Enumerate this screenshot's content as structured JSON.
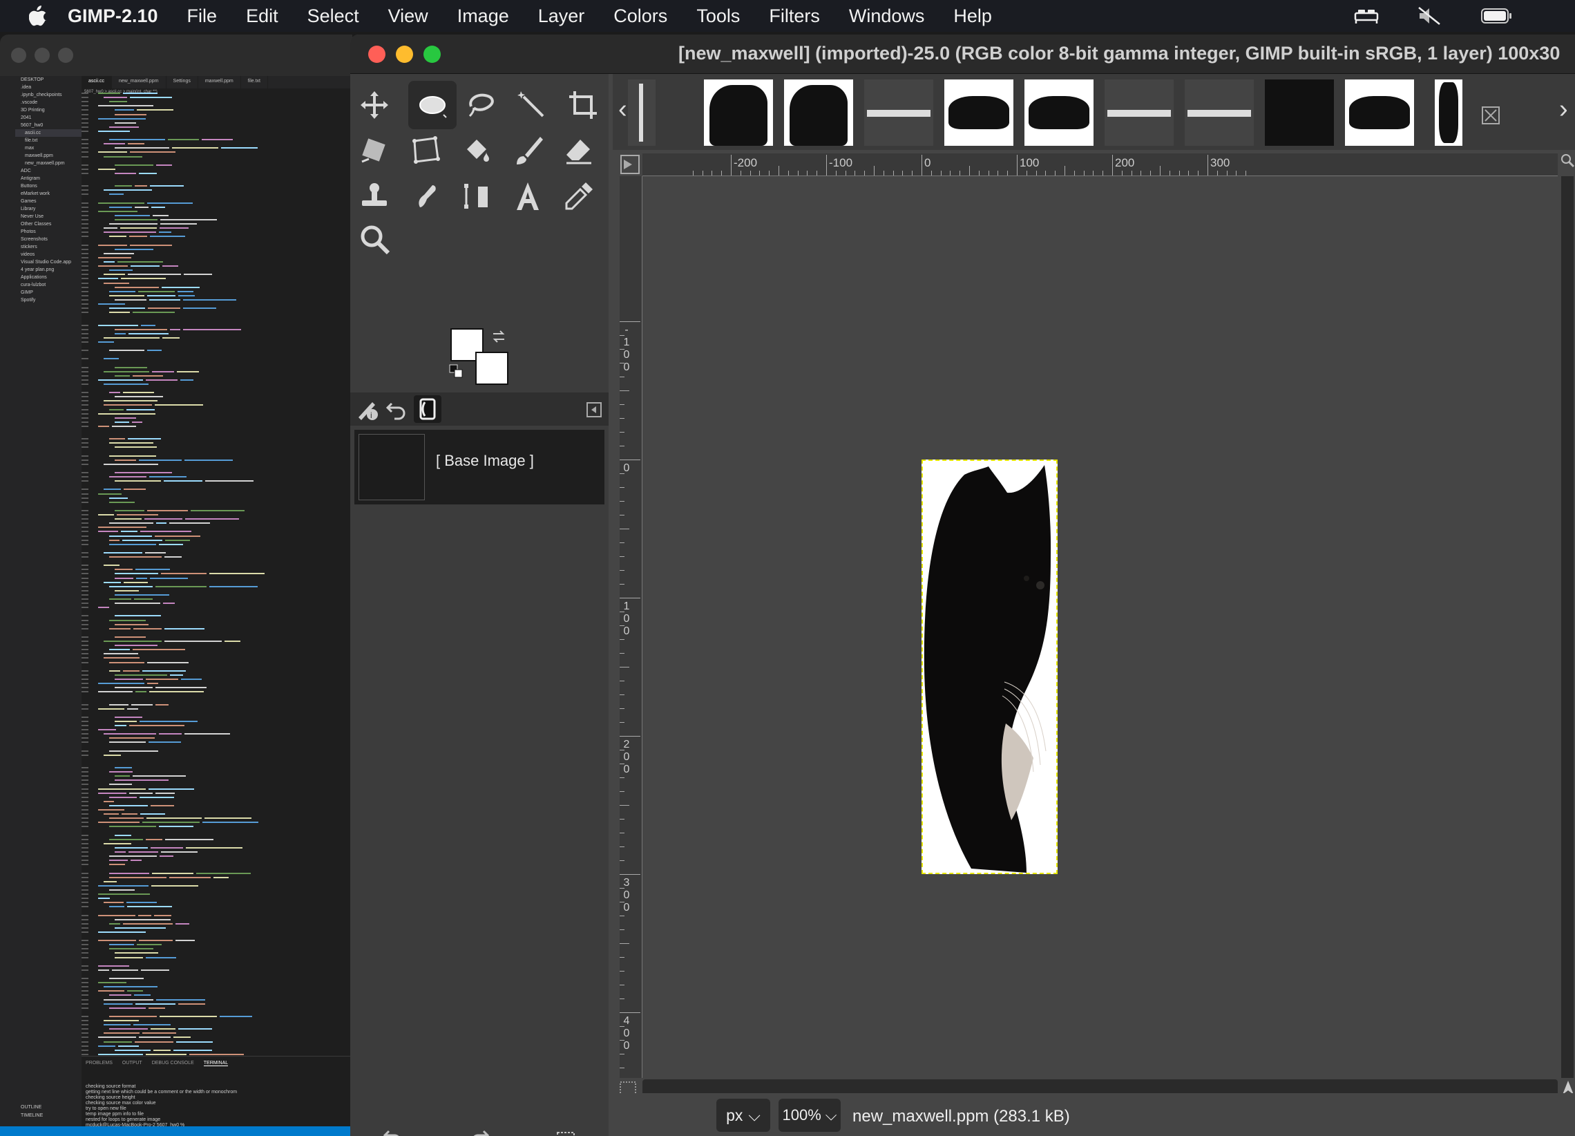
{
  "menubar": {
    "app_name": "GIMP-2.10",
    "items": [
      "File",
      "Edit",
      "Select",
      "View",
      "Image",
      "Layer",
      "Colors",
      "Tools",
      "Filters",
      "Windows",
      "Help"
    ],
    "status_icons": [
      "bed-icon",
      "mute-icon",
      "battery-icon"
    ]
  },
  "vscode": {
    "tabs": [
      "ascii.cc",
      "new_maxwell.ppm",
      "Settings",
      "maxwell.ppm",
      "file.txt"
    ],
    "breadcrumb": "5607_hw0 > ascii.cc > main(int, char **)",
    "explorer": [
      "DESKTOP",
      ".idea",
      ".ipynb_checkpoints",
      ".vscode",
      "3D Printing",
      "2041",
      "5607_hw0",
      "ascii.cc",
      "file.txt",
      "max",
      "maxwell.ppm",
      "new_maxwell.ppm",
      "ADC",
      "Antigram",
      "Buttons",
      "eMarket work",
      "Games",
      "Library",
      "Never Use",
      "Other Classes",
      "Photos",
      "Screenshots",
      "stickers",
      "videos",
      "Visual Studio Code.app",
      "4 year plan.png",
      "Applications",
      "cura-lulzbot",
      "GIMP",
      "Spotify"
    ],
    "terminal_tabs": [
      "PROBLEMS",
      "OUTPUT",
      "DEBUG CONSOLE",
      "TERMINAL"
    ],
    "terminal_lines": [
      "checking source format",
      "getting next line which could be a comment or the width or monochrom",
      "checking source height",
      "checking source max color value",
      "try to open new file",
      "temp image ppm info to file",
      "nested for loops to generate image",
      "mcduck@Lucas-MacBook-Pro-2 5607_hw0 %"
    ],
    "outline_label": "OUTLINE",
    "timeline_label": "TIMELINE"
  },
  "gimp": {
    "window_title": "[new_maxwell] (imported)-25.0 (RGB color 8-bit gamma integer, GIMP built-in sRGB, 1 layer) 100x30",
    "layer_name": "[ Base Image ]",
    "ruler_labels": [
      "-200",
      "-100",
      "0",
      "100",
      "200",
      "300"
    ],
    "vruler_labels": [
      "-100",
      "0",
      "100",
      "200",
      "300",
      "400"
    ],
    "unit": "px",
    "zoom": "100%",
    "file_info": "new_maxwell.ppm (283.1 kB)",
    "accent_yellow": "#e6e600"
  }
}
